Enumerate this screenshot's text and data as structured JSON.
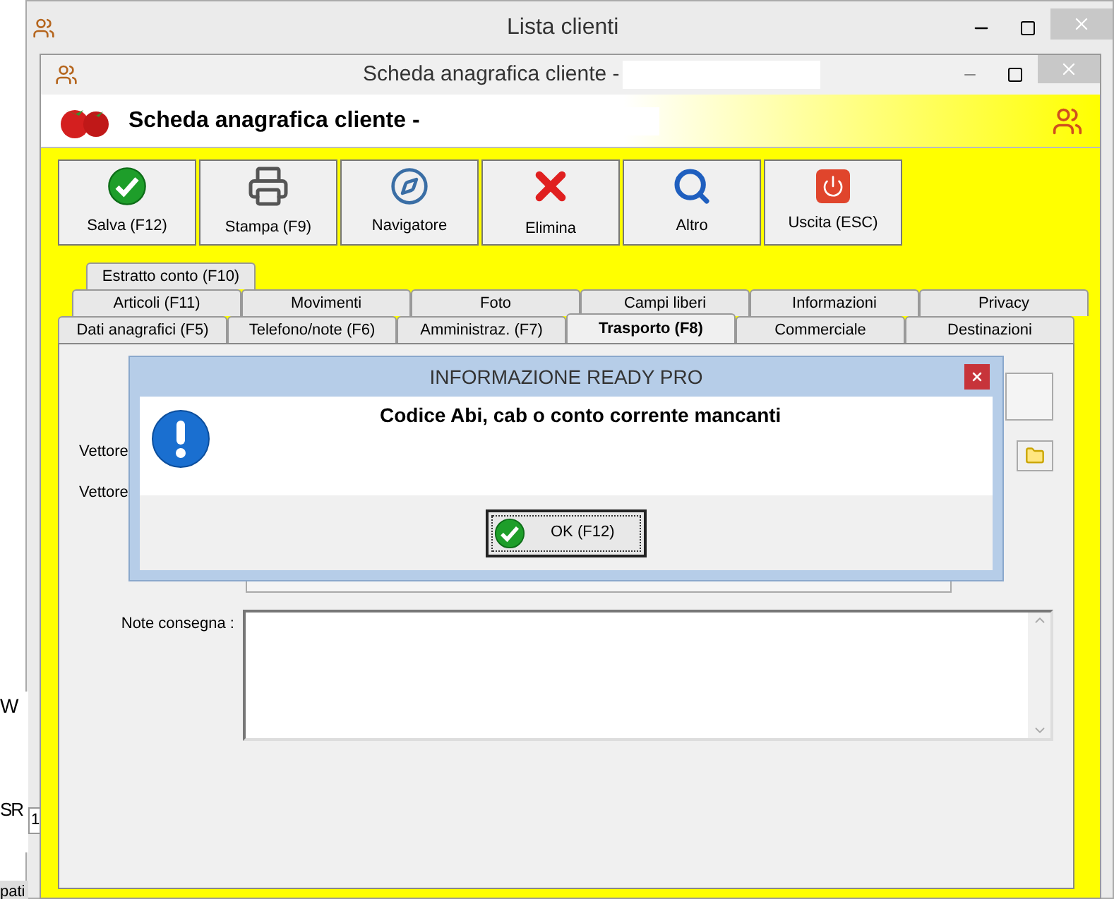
{
  "background_window": {
    "title": "Lista clienti",
    "fragments": [
      "W",
      "SR",
      "1",
      "pati"
    ]
  },
  "window": {
    "title": "Scheda anagrafica cliente -"
  },
  "header": {
    "title": "Scheda anagrafica cliente -"
  },
  "toolbar": [
    {
      "kind": "save",
      "label": "Salva (F12)"
    },
    {
      "kind": "print",
      "label": "Stampa (F9)"
    },
    {
      "kind": "navigator",
      "label": "Navigatore"
    },
    {
      "kind": "delete",
      "label": "Elimina"
    },
    {
      "kind": "more",
      "label": "Altro"
    },
    {
      "kind": "exit",
      "label": "Uscita (ESC)"
    }
  ],
  "tab_rows": [
    [
      {
        "label": "Estratto conto (F10)",
        "selected": false
      }
    ],
    [
      {
        "label": "Articoli (F11)",
        "selected": false
      },
      {
        "label": "Movimenti",
        "selected": false
      },
      {
        "label": "Foto",
        "selected": false
      },
      {
        "label": "Campi liberi",
        "selected": false
      },
      {
        "label": "Informazioni",
        "selected": false
      },
      {
        "label": "Privacy",
        "selected": false
      }
    ],
    [
      {
        "label": "Dati anagrafici (F5)",
        "selected": false
      },
      {
        "label": "Telefono/note (F6)",
        "selected": false
      },
      {
        "label": "Amministraz. (F7)",
        "selected": false
      },
      {
        "label": "Trasporto (F8)",
        "selected": true
      },
      {
        "label": "Commerciale",
        "selected": false
      },
      {
        "label": "Destinazioni",
        "selected": false
      }
    ]
  ],
  "form": {
    "labels": [
      "Vettore",
      "Vettore"
    ],
    "notes_label": "Note consegna :"
  },
  "dialog": {
    "title": "INFORMAZIONE READY PRO",
    "message": "Codice Abi, cab o conto corrente mancanti",
    "button": "OK (F12)"
  }
}
